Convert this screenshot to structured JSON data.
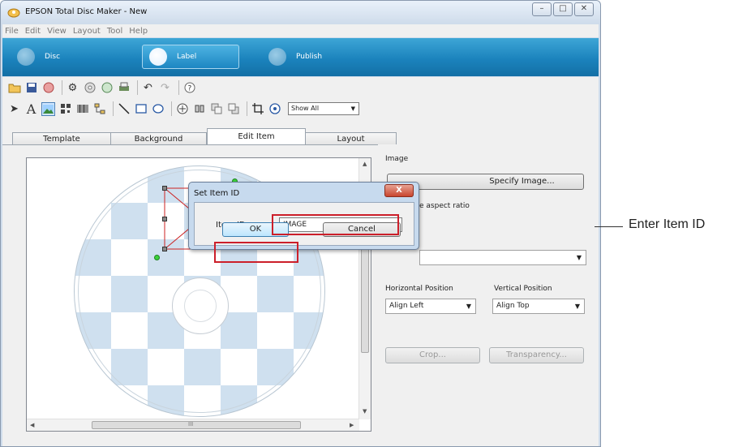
{
  "window": {
    "title": "EPSON Total Disc Maker - New",
    "controls": [
      "–",
      "□",
      "✕"
    ]
  },
  "menu": [
    "File",
    "Edit",
    "View",
    "Layout",
    "Tool",
    "Help"
  ],
  "modes": [
    {
      "label": "Disc",
      "active": false
    },
    {
      "label": "Label",
      "active": true
    },
    {
      "label": "Publish",
      "active": false
    }
  ],
  "toolbar2": {
    "display_filter": "Show All"
  },
  "tabs": [
    "Template",
    "Background",
    "Edit Item",
    "Layout"
  ],
  "active_tab": "Edit Item",
  "canvas": {
    "hscroll_grip": "III"
  },
  "right_panel": {
    "section_label": "Image",
    "specify_image_button": "Specify Image...",
    "aspect_ratio_text": "e aspect ratio",
    "horizontal_position_label": "Horizontal Position",
    "horizontal_position_value": "Align Left",
    "vertical_position_label": "Vertical Position",
    "vertical_position_value": "Align Top",
    "crop_button": "Crop...",
    "transparency_button": "Transparency..."
  },
  "dialog": {
    "title": "Set Item ID",
    "close_label": "X",
    "item_id_label": "Item ID",
    "item_id_value": "IMAGE",
    "ok_button": "OK",
    "cancel_button": "Cancel"
  },
  "annotation": {
    "callout_text": "Enter Item ID"
  },
  "colors": {
    "accent_blue": "#1b83bd",
    "highlight_red": "#cc1f2a",
    "disc_pattern": "#cfe0ef"
  }
}
